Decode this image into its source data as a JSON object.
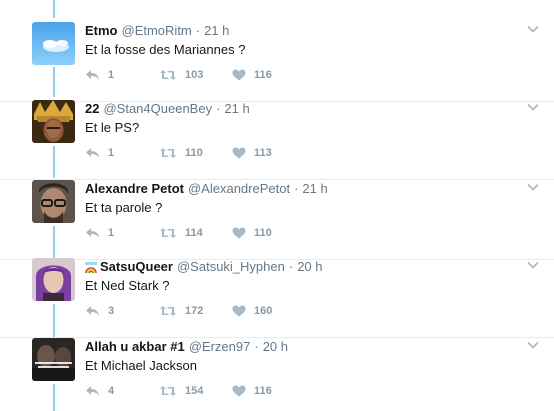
{
  "tweets": [
    {
      "name": "Etmo",
      "handle": "@EtmoRitm",
      "time": "21 h",
      "text": "Et la fosse des Mariannes ?",
      "replies": "1",
      "retweets": "103",
      "likes": "116",
      "avatar": "sky-clouds-avatar"
    },
    {
      "name": "22",
      "handle": "@Stan4QueenBey",
      "time": "21 h",
      "text": "Et le PS?",
      "replies": "1",
      "retweets": "110",
      "likes": "113",
      "avatar": "gold-crown-avatar"
    },
    {
      "name": "Alexandre Petot",
      "handle": "@AlexandrePetot",
      "time": "21 h",
      "text": "Et ta parole ?",
      "replies": "1",
      "retweets": "114",
      "likes": "110",
      "avatar": "man-glasses-avatar"
    },
    {
      "name": "SatsuQueer",
      "handle": "@Satsuki_Hyphen",
      "time": "20 h",
      "text": "Et Ned Stark ?",
      "replies": "3",
      "retweets": "172",
      "likes": "160",
      "avatar": "purple-hair-avatar",
      "name_emoji": "rainbow-icon"
    },
    {
      "name": "Allah u akbar #1",
      "handle": "@Erzen97",
      "time": "20 h",
      "text": "Et Michael Jackson",
      "replies": "4",
      "retweets": "154",
      "likes": "116",
      "avatar": "dark-meme-avatar"
    }
  ],
  "separator": "·",
  "colors": {
    "thread_line": "#8ecdf8",
    "icon": "#aab8c2",
    "secondary_text": "#657786"
  }
}
